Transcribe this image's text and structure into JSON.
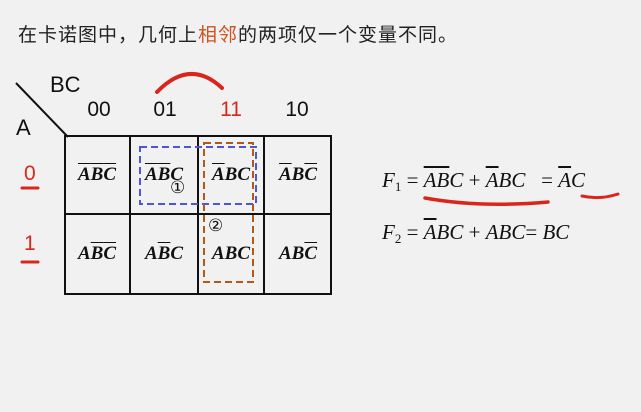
{
  "heading": {
    "pre": "在卡诺图中，几何上",
    "highlight": "相邻",
    "post": "的两项仅一个变量不同。"
  },
  "kmap": {
    "col_var": "BC",
    "row_var": "A",
    "columns": [
      "00",
      "01",
      "11",
      "10"
    ],
    "rows": [
      "0",
      "1"
    ],
    "cells": [
      [
        [
          "A",
          "B",
          "C"
        ],
        [
          true,
          true,
          true
        ]
      ],
      [
        [
          "A",
          "B",
          "C"
        ],
        [
          true,
          true,
          false
        ]
      ],
      [
        [
          "A",
          "B",
          "C"
        ],
        [
          true,
          false,
          false
        ]
      ],
      [
        [
          "A",
          "B",
          "C"
        ],
        [
          true,
          false,
          true
        ]
      ],
      [
        [
          "A",
          "B",
          "C"
        ],
        [
          false,
          true,
          true
        ]
      ],
      [
        [
          "A",
          "B",
          "C"
        ],
        [
          false,
          true,
          false
        ]
      ],
      [
        [
          "A",
          "B",
          "C"
        ],
        [
          false,
          false,
          false
        ]
      ],
      [
        [
          "A",
          "B",
          "C"
        ],
        [
          false,
          false,
          true
        ]
      ]
    ],
    "group_labels": [
      "①",
      "②"
    ]
  },
  "formulas": {
    "f1": {
      "name": "F",
      "sub": "1"
    },
    "f2": {
      "name": "F",
      "sub": "2",
      "rhs_result": "BC"
    }
  },
  "colors": {
    "accent_red": "#d8261c",
    "highlight_orange": "#d0521d",
    "group1_blue": "#4b58d1",
    "group2_brown": "#b0591b"
  }
}
